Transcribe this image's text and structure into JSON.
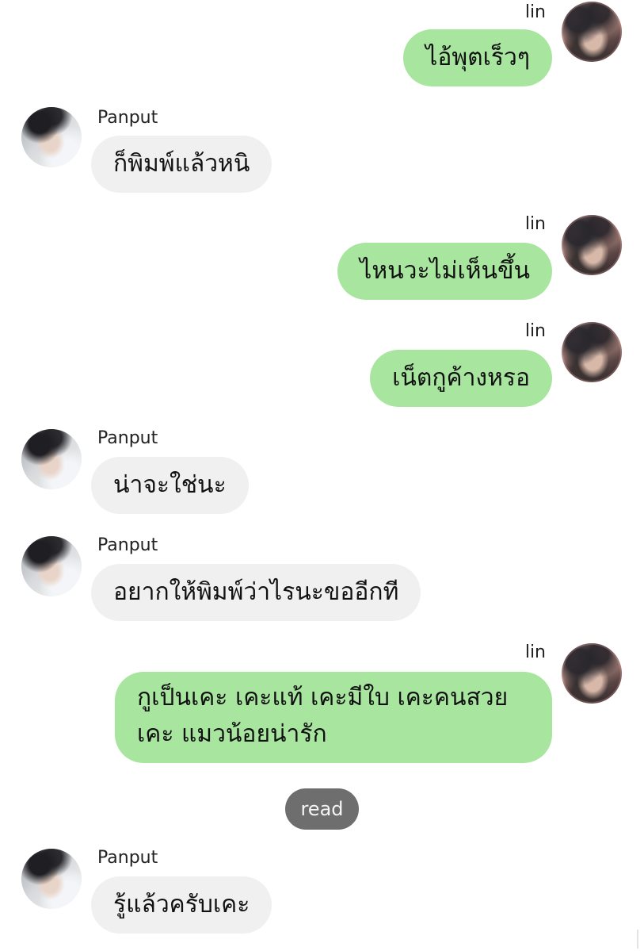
{
  "messages": [
    {
      "sender": "lin",
      "text": "ไอ้พุตเร็วๆ"
    },
    {
      "sender": "Panput",
      "text": "ก็พิมพ์แล้วหนิ"
    },
    {
      "sender": "lin",
      "text": "ไหนวะไม่เห็นขึ้น"
    },
    {
      "sender": "lin",
      "text": "เน็ตกูค้างหรอ"
    },
    {
      "sender": "Panput",
      "text": "น่าจะใช่นะ"
    },
    {
      "sender": "Panput",
      "text": "อยากให้พิมพ์ว่าไรนะขออีกที"
    },
    {
      "sender": "lin",
      "text": "กูเป็นเคะ เคะแท้ เคะมีใบ เคะคนสวย เคะ แมวน้อยน่ารัก"
    },
    {
      "sender": "Panput",
      "text": "รู้แล้วครับเคะ"
    }
  ],
  "status": {
    "read_label": "read"
  },
  "colors": {
    "outgoing_bubble": "#a8e6a0",
    "incoming_bubble": "#f0f0f0",
    "read_pill": "#6e6e6e"
  }
}
